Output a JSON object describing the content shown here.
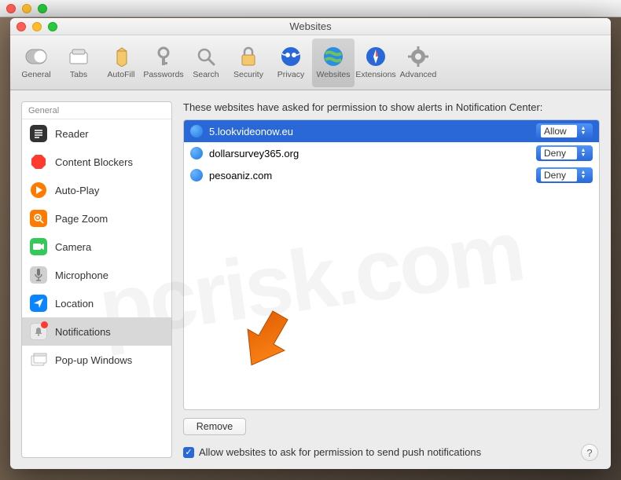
{
  "window": {
    "title": "Websites"
  },
  "toolbar": {
    "items": [
      {
        "label": "General"
      },
      {
        "label": "Tabs"
      },
      {
        "label": "AutoFill"
      },
      {
        "label": "Passwords"
      },
      {
        "label": "Search"
      },
      {
        "label": "Security"
      },
      {
        "label": "Privacy"
      },
      {
        "label": "Websites"
      },
      {
        "label": "Extensions"
      },
      {
        "label": "Advanced"
      }
    ]
  },
  "sidebar": {
    "header": "General",
    "items": [
      {
        "label": "Reader"
      },
      {
        "label": "Content Blockers"
      },
      {
        "label": "Auto-Play"
      },
      {
        "label": "Page Zoom"
      },
      {
        "label": "Camera"
      },
      {
        "label": "Microphone"
      },
      {
        "label": "Location"
      },
      {
        "label": "Notifications"
      },
      {
        "label": "Pop-up Windows"
      }
    ]
  },
  "main": {
    "header": "These websites have asked for permission to show alerts in Notification Center:",
    "sites": [
      {
        "domain": "5.lookvideonow.eu",
        "permission": "Allow"
      },
      {
        "domain": "dollarsurvey365.org",
        "permission": "Deny"
      },
      {
        "domain": "pesoaniz.com",
        "permission": "Deny"
      }
    ],
    "remove_label": "Remove",
    "checkbox_label": "Allow websites to ask for permission to send push notifications"
  },
  "help": "?"
}
